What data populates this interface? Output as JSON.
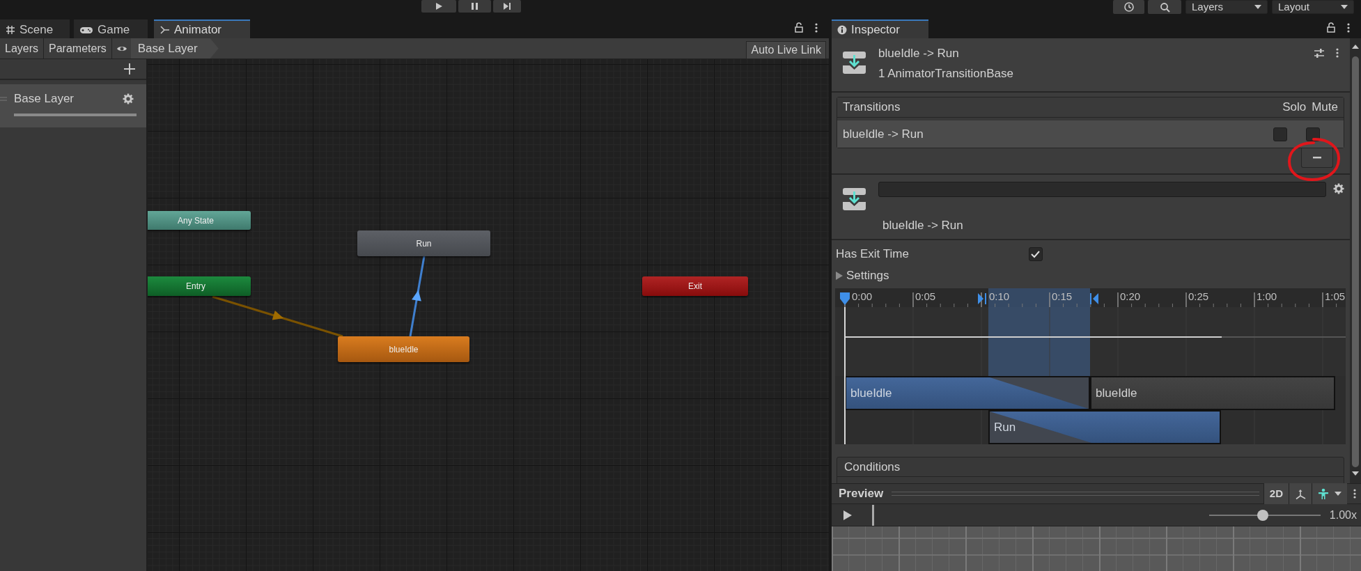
{
  "toolbar": {
    "layers_dropdown": "Layers",
    "layout_dropdown": "Layout"
  },
  "editor_tabs": [
    {
      "label": "Scene",
      "kind": "scene",
      "selected": false
    },
    {
      "label": "Game",
      "kind": "game",
      "selected": false
    },
    {
      "label": "Animator",
      "kind": "animator",
      "selected": true
    }
  ],
  "animator": {
    "panel_tabs": [
      {
        "label": "Layers"
      },
      {
        "label": "Parameters"
      }
    ],
    "breadcrumb": "Base Layer",
    "live_link_button": "Auto Live Link",
    "layers": [
      {
        "name": "Base Layer",
        "selected": true
      }
    ],
    "states": [
      {
        "label": "Any State",
        "kind": "any"
      },
      {
        "label": "Run",
        "kind": "state"
      },
      {
        "label": "Entry",
        "kind": "entry"
      },
      {
        "label": "Exit",
        "kind": "exit"
      },
      {
        "label": "blueIdle",
        "kind": "default"
      }
    ],
    "transitions": [
      {
        "kind": "entry",
        "selected": false
      },
      {
        "kind": "state",
        "selected": true
      }
    ]
  },
  "inspector": {
    "tab": "Inspector",
    "title": "blueIdle -> Run",
    "subtitle": "1 AnimatorTransitionBase",
    "transition_list": {
      "header": "Transitions",
      "solo_header": "Solo",
      "mute_header": "Mute",
      "rows": [
        {
          "name": "blueIdle -> Run",
          "solo": false,
          "mute": false
        }
      ]
    },
    "transition": {
      "label": "blueIdle -> Run"
    },
    "has_exit_time": {
      "label": "Has Exit Time",
      "checked": true
    },
    "settings": {
      "label": "Settings",
      "expanded": false
    },
    "timeline": {
      "ticks": [
        "0:00",
        "0:05",
        "0:10",
        "0:15",
        "0:20",
        "0:25",
        "1:00",
        "1:05"
      ],
      "clips": [
        {
          "label": "blueIdle",
          "kind": "source"
        },
        {
          "label": "blueIdle",
          "kind": "source_after"
        },
        {
          "label": "Run",
          "kind": "target"
        }
      ]
    },
    "conditions": {
      "header": "Conditions"
    }
  },
  "preview": {
    "title": "Preview",
    "mode_button": "2D",
    "speed": "1.00x",
    "speed_slider": {
      "level": 0.48
    }
  },
  "annotations": [
    {
      "kind": "circle"
    }
  ]
}
